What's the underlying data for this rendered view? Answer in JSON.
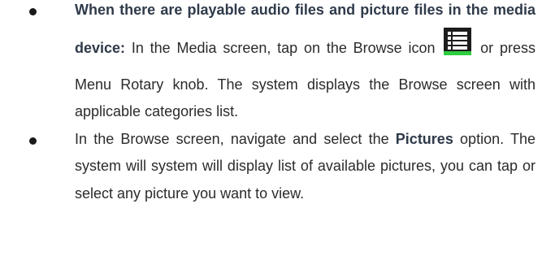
{
  "bullet_1": {
    "bold_lead": "When there are playable audio files and picture files in the media device:",
    "text_a": " In the Media screen, tap on the ",
    "text_b": "Browse icon",
    "text_c": " or press Menu Rotary knob. The system displays the Browse screen with applicable categories list.",
    "icon": "browse-list-icon",
    "icon_color": "#1c1c1c",
    "icon_accent": "#2ecc40"
  },
  "bullet_2": {
    "text_a": "In the Browse screen, navigate and select the ",
    "bold_word": "Pictures",
    "text_b": " option. The system will system will display list of available pictures, you can tap or select any picture you want to view."
  }
}
